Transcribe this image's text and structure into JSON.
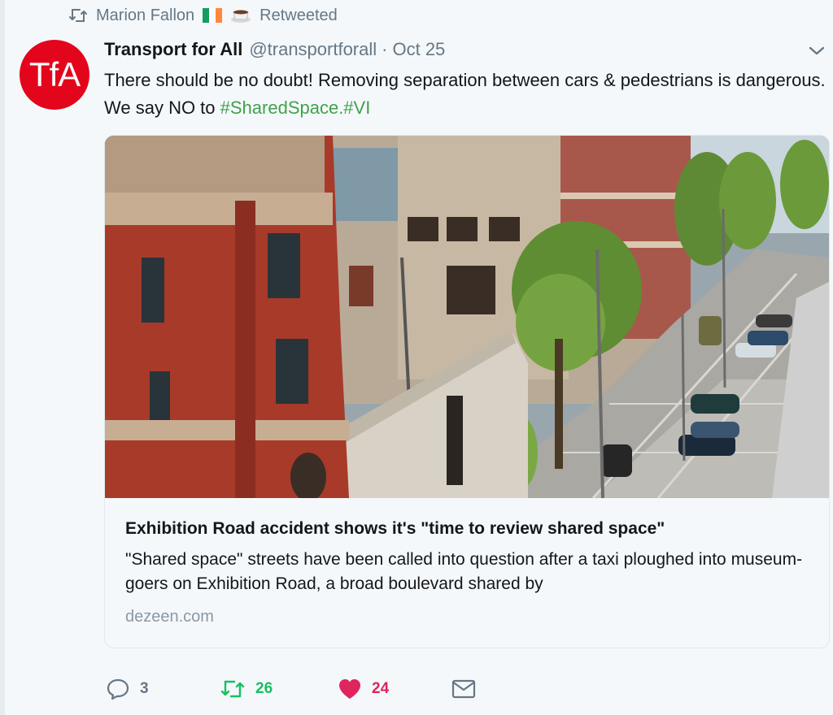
{
  "retweet_context": {
    "icon": "retweet-icon",
    "user": "Marion Fallon",
    "emoji": [
      "ireland-flag-emoji",
      "coffee-emoji"
    ],
    "label": "Retweeted"
  },
  "tweet": {
    "avatar_text": "TfA",
    "author_name": "Transport for All",
    "handle": "@transportforall",
    "separator": "·",
    "date": "Oct 25",
    "text_plain": "There should be no doubt! Removing separation between cars & pedestrians is dangerous. We say NO to ",
    "hashtags": "#SharedSpace.#VI",
    "menu_icon": "chevron-down-icon"
  },
  "card": {
    "image_alt": "Aerial view of Exhibition Road with museum buildings, trees and cars",
    "title": "Exhibition Road accident shows it's \"time to review shared space\"",
    "description": "\"Shared space\" streets have been called into question after a taxi ploughed into museum-goers on Exhibition Road, a broad boulevard shared by",
    "domain": "dezeen.com"
  },
  "actions": {
    "reply_count": "3",
    "retweet_count": "26",
    "like_count": "24",
    "reply_icon": "reply-icon",
    "retweet_icon": "retweet-icon",
    "like_icon": "heart-icon",
    "dm_icon": "envelope-icon"
  },
  "colors": {
    "brand_red": "#e3051b",
    "hashtag_green": "#3fa34d",
    "retweet_green": "#17bf63",
    "like_pink": "#e0245e",
    "muted": "#657786",
    "background": "#f5f8fa"
  }
}
